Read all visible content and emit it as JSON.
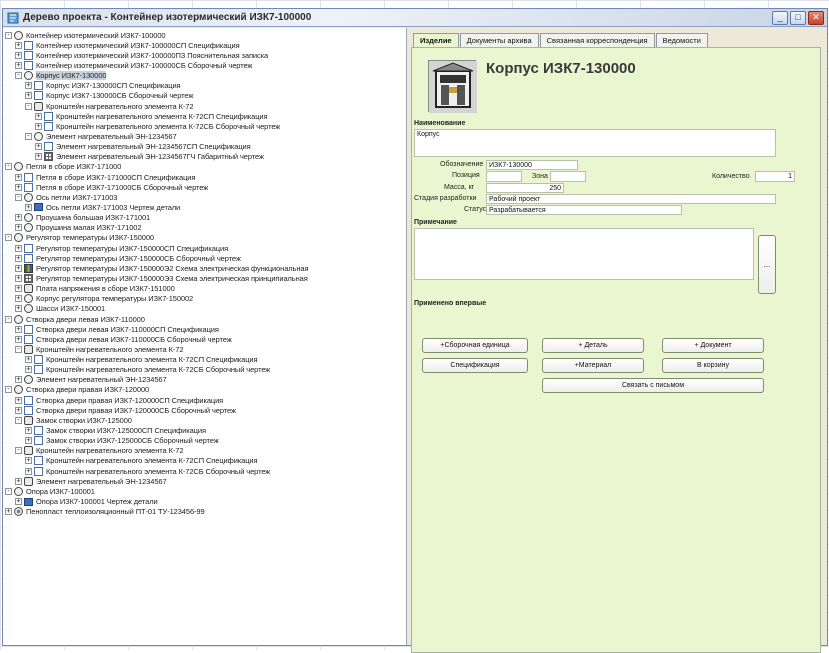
{
  "window": {
    "title": "Дерево проекта - Контейнер изотермический ИЗК7-100000"
  },
  "tree": {
    "items": [
      {
        "depth": 0,
        "icon": "assembly",
        "expander": "-",
        "label": "Контейнер изотермический ИЗК7-100000"
      },
      {
        "depth": 1,
        "icon": "doc",
        "expander": "+",
        "label": "Контейнер изотермический ИЗК7-100000СП Спецификация"
      },
      {
        "depth": 1,
        "icon": "doc",
        "expander": "+",
        "label": "Контейнер изотермический ИЗК7-100000ПЗ Пояснительная записка"
      },
      {
        "depth": 1,
        "icon": "doc",
        "expander": "+",
        "label": "Контейнер изотермический ИЗК7-100000СБ Сборочный чертеж"
      },
      {
        "depth": 1,
        "icon": "assembly",
        "expander": "-",
        "label": "Корпус ИЗК7-130000",
        "selected": true
      },
      {
        "depth": 2,
        "icon": "doc",
        "expander": "+",
        "label": "Корпус ИЗК7-130000СП Спецификация"
      },
      {
        "depth": 2,
        "icon": "doc",
        "expander": "+",
        "label": "Корпус ИЗК7-130000СБ Сборочный чертеж"
      },
      {
        "depth": 2,
        "icon": "part",
        "expander": "-",
        "label": "Кронштейн нагревательного элемента К-72"
      },
      {
        "depth": 3,
        "icon": "doc",
        "expander": "+",
        "label": "Кронштейн нагревательного элемента К-72СП Спецификация"
      },
      {
        "depth": 3,
        "icon": "doc",
        "expander": "+",
        "label": "Кронштейн нагревательного элемента К-72СБ Сборочный чертеж"
      },
      {
        "depth": 2,
        "icon": "assembly",
        "expander": "-",
        "label": "Элемент нагревательный ЭН-1234567"
      },
      {
        "depth": 3,
        "icon": "doc",
        "expander": "+",
        "label": "Элемент нагревательный ЭН-1234567СП Спецификация"
      },
      {
        "depth": 3,
        "icon": "grid",
        "expander": "+",
        "label": "Элемент нагревательный ЭН-1234567ГЧ Габаритный чертеж"
      },
      {
        "depth": 0,
        "icon": "assembly",
        "expander": "-",
        "label": "Петля в сборе ИЗК7-171000"
      },
      {
        "depth": 1,
        "icon": "doc",
        "expander": "+",
        "label": "Петля в сборе ИЗК7-171000СП Спецификация"
      },
      {
        "depth": 1,
        "icon": "doc",
        "expander": "+",
        "label": "Петля в сборе ИЗК7-171000СБ Сборочный чертеж"
      },
      {
        "depth": 1,
        "icon": "assembly",
        "expander": "-",
        "label": "Ось петли ИЗК7-171003"
      },
      {
        "depth": 2,
        "icon": "blue",
        "expander": "+",
        "label": "Ось петли ИЗК7-171003 Чертеж детали"
      },
      {
        "depth": 1,
        "icon": "assembly",
        "expander": "+",
        "label": "Проушина большая ИЗК7-171001"
      },
      {
        "depth": 1,
        "icon": "assembly",
        "expander": "+",
        "label": "Проушина малая ИЗК7-171002"
      },
      {
        "depth": 0,
        "icon": "assembly",
        "expander": "-",
        "label": "Регулятор температуры ИЗК7-150000"
      },
      {
        "depth": 1,
        "icon": "doc",
        "expander": "+",
        "label": "Регулятор температуры ИЗК7-150000СП Спецификация"
      },
      {
        "depth": 1,
        "icon": "doc",
        "expander": "+",
        "label": "Регулятор температуры ИЗК7-150000СБ Сборочный чертеж"
      },
      {
        "depth": 1,
        "icon": "multi",
        "expander": "+",
        "label": "Регулятор температуры ИЗК7-150000Э2 Схема электрическая функциональная"
      },
      {
        "depth": 1,
        "icon": "grid",
        "expander": "+",
        "label": "Регулятор температуры ИЗК7-150000Э3 Схема электрическая принципиальная"
      },
      {
        "depth": 1,
        "icon": "part",
        "expander": "+",
        "label": "Плата напряжения в сборе ИЗК7-151000"
      },
      {
        "depth": 1,
        "icon": "assembly",
        "expander": "+",
        "label": "Корпус регулятора температуры ИЗК7-150002"
      },
      {
        "depth": 1,
        "icon": "assembly",
        "expander": "+",
        "label": "Шасси ИЗК7-150001"
      },
      {
        "depth": 0,
        "icon": "assembly",
        "expander": "-",
        "label": "Створка двери левая ИЗК7-110000"
      },
      {
        "depth": 1,
        "icon": "doc",
        "expander": "+",
        "label": "Створка двери левая ИЗК7-110000СП Спецификация"
      },
      {
        "depth": 1,
        "icon": "doc",
        "expander": "+",
        "label": "Створка двери левая ИЗК7-110000СБ Сборочный чертеж"
      },
      {
        "depth": 1,
        "icon": "part",
        "expander": "-",
        "label": "Кронштейн нагревательного элемента К-72"
      },
      {
        "depth": 2,
        "icon": "doc",
        "expander": "+",
        "label": "Кронштейн нагревательного элемента К-72СП Спецификация"
      },
      {
        "depth": 2,
        "icon": "doc",
        "expander": "+",
        "label": "Кронштейн нагревательного элемента К-72СБ Сборочный чертеж"
      },
      {
        "depth": 1,
        "icon": "assembly",
        "expander": "+",
        "label": "Элемент нагревательный ЭН-1234567"
      },
      {
        "depth": 0,
        "icon": "assembly",
        "expander": "-",
        "label": "Створка двери правая ИЗК7-120000"
      },
      {
        "depth": 1,
        "icon": "doc",
        "expander": "+",
        "label": "Створка двери правая ИЗК7-120000СП Спецификация"
      },
      {
        "depth": 1,
        "icon": "doc",
        "expander": "+",
        "label": "Створка двери правая ИЗК7-120000СБ Сборочный чертеж"
      },
      {
        "depth": 1,
        "icon": "part",
        "expander": "-",
        "label": "Замок створки ИЗК7-125000"
      },
      {
        "depth": 2,
        "icon": "doc",
        "expander": "+",
        "label": "Замок створки ИЗК7-125000СП Спецификация"
      },
      {
        "depth": 2,
        "icon": "doc",
        "expander": "+",
        "label": "Замок створки ИЗК7-125000СБ Сборочный чертеж"
      },
      {
        "depth": 1,
        "icon": "part",
        "expander": "-",
        "label": "Кронштейн нагревательного элемента К-72"
      },
      {
        "depth": 2,
        "icon": "doc",
        "expander": "+",
        "label": "Кронштейн нагревательного элемента К-72СП Спецификация"
      },
      {
        "depth": 2,
        "icon": "doc",
        "expander": "+",
        "label": "Кронштейн нагревательного элемента К-72СБ Сборочный чертеж"
      },
      {
        "depth": 1,
        "icon": "part",
        "expander": "+",
        "label": "Элемент нагревательный ЭН-1234567"
      },
      {
        "depth": 0,
        "icon": "assembly",
        "expander": "-",
        "label": "Опора ИЗК7-100001"
      },
      {
        "depth": 1,
        "icon": "blue",
        "expander": "+",
        "label": "Опора ИЗК7-100001 Чертеж детали"
      },
      {
        "depth": 0,
        "icon": "mat",
        "expander": "+",
        "label": "Пенопласт теплоизоляционный ПТ-01 ТУ-123456-99"
      }
    ]
  },
  "tabs": [
    {
      "label": "Изделие",
      "active": true
    },
    {
      "label": "Документы архива",
      "active": false
    },
    {
      "label": "Связанная корреспонденция",
      "active": false
    },
    {
      "label": "Ведомости",
      "active": false
    }
  ],
  "item": {
    "title": "Корпус ИЗК7-130000",
    "name_label": "Наименование",
    "name_value": "Корпус",
    "designation_label": "Обозначение",
    "designation_value": "ИЗК7-130000",
    "position_label": "Позиция",
    "position_value": "",
    "zone_label": "Зона",
    "zone_value": "",
    "quantity_label": "Количество",
    "quantity_value": "1",
    "mass_label": "Масса, кг",
    "mass_value": "250",
    "stage_label": "Стадия разработки",
    "stage_value": "Рабочий проект",
    "status_label": "Статус",
    "status_value": "Разрабатывается",
    "note_label": "Примечание",
    "note_value": "",
    "first_applied_label": "Применено впервые",
    "ellipsis": "..."
  },
  "buttons": {
    "add_assembly": "+Сборочная единица",
    "add_part": "+ Деталь",
    "add_document": "+ Документ",
    "specification": "Спецификация",
    "material": "+Материал",
    "to_cart": "В корзину",
    "link_with": "Связать с письмом"
  },
  "colors": {
    "panel_bg": "#eaf6cf",
    "selection": "#c9d2dd"
  }
}
